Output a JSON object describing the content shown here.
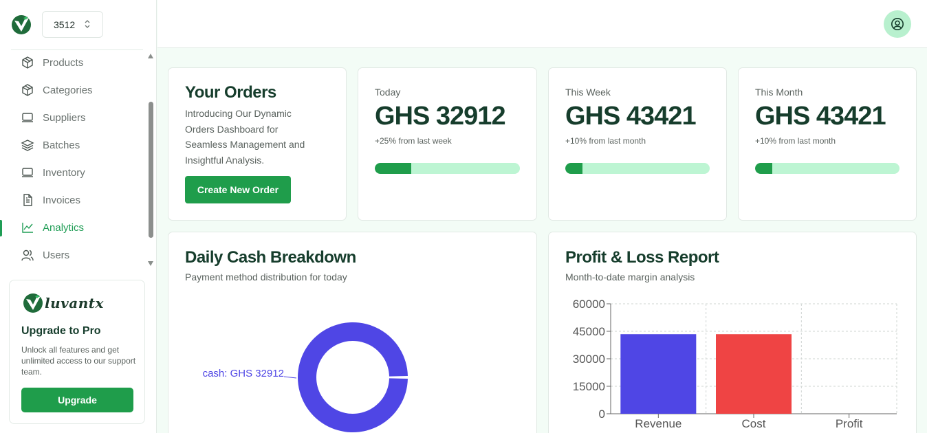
{
  "store_selector": {
    "value": "3512"
  },
  "sidebar": {
    "items": [
      {
        "label": "Products",
        "icon": "box-icon",
        "active": false
      },
      {
        "label": "Categories",
        "icon": "box-icon",
        "active": false
      },
      {
        "label": "Suppliers",
        "icon": "monitor-icon",
        "active": false
      },
      {
        "label": "Batches",
        "icon": "layers-icon",
        "active": false
      },
      {
        "label": "Inventory",
        "icon": "monitor-icon",
        "active": false
      },
      {
        "label": "Invoices",
        "icon": "document-icon",
        "active": false
      },
      {
        "label": "Analytics",
        "icon": "line-chart-icon",
        "active": true
      },
      {
        "label": "Users",
        "icon": "users-icon",
        "active": false
      }
    ]
  },
  "promo": {
    "brand": "luvantx",
    "title": "Upgrade to Pro",
    "text": "Unlock all features and get unlimited access to our support team.",
    "button": "Upgrade"
  },
  "orders": {
    "title": "Your Orders",
    "description": "Introducing Our Dynamic Orders Dashboard for Seamless Management and Insightful Analysis.",
    "button": "Create New Order"
  },
  "stats": [
    {
      "label": "Today",
      "value": "GHS 32912",
      "sub": "+25% from last week",
      "progress": 0.25
    },
    {
      "label": "This Week",
      "value": "GHS 43421",
      "sub": "+10% from last month",
      "progress": 0.12
    },
    {
      "label": "This Month",
      "value": "GHS 43421",
      "sub": "+10% from last month",
      "progress": 0.12
    }
  ],
  "cash_breakdown": {
    "title": "Daily Cash Breakdown",
    "subtitle": "Payment method distribution for today"
  },
  "profit_loss": {
    "title": "Profit & Loss Report",
    "subtitle": "Month-to-date margin analysis"
  },
  "colors": {
    "brand_green": "#1f9d4b",
    "progress_track": "#bdf5d3",
    "donut": "#4f46e5",
    "revenue_bar": "#4f46e5",
    "cost_bar": "#ef4444"
  },
  "chart_data": [
    {
      "type": "pie",
      "labels": [
        "cash"
      ],
      "values": [
        32912
      ],
      "slice_labels": [
        "cash: GHS 32912"
      ]
    },
    {
      "type": "bar",
      "categories": [
        "Revenue",
        "Cost",
        "Profit"
      ],
      "values": [
        43421,
        43421,
        0
      ],
      "ylim": [
        0,
        60000
      ],
      "yticks": [
        "0",
        "15000",
        "30000",
        "45000",
        "60000"
      ],
      "grid": true
    }
  ]
}
